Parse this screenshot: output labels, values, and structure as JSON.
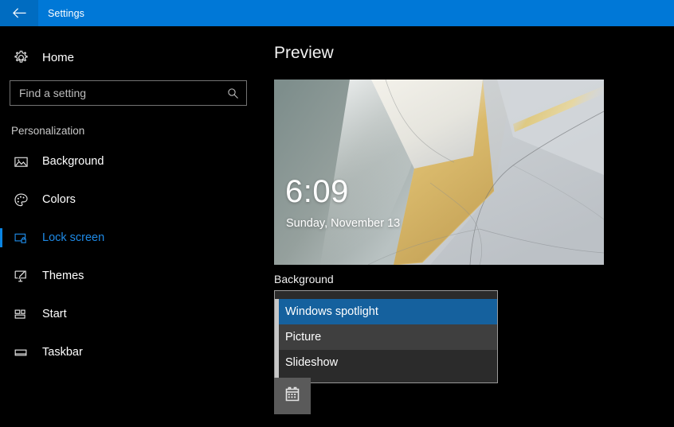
{
  "window": {
    "title": "Settings",
    "back_icon": "back-arrow-icon",
    "accent_color": "#0078d7"
  },
  "sidebar": {
    "home": {
      "label": "Home",
      "icon": "gear-icon"
    },
    "search": {
      "placeholder": "Find a setting",
      "value": "",
      "icon": "search-icon"
    },
    "section_header": "Personalization",
    "items": [
      {
        "label": "Background",
        "icon": "image-icon",
        "selected": false
      },
      {
        "label": "Colors",
        "icon": "palette-icon",
        "selected": false
      },
      {
        "label": "Lock screen",
        "icon": "lock-screen-icon",
        "selected": true
      },
      {
        "label": "Themes",
        "icon": "brush-icon",
        "selected": false
      },
      {
        "label": "Start",
        "icon": "tiles-icon",
        "selected": false
      },
      {
        "label": "Taskbar",
        "icon": "taskbar-icon",
        "selected": false
      }
    ],
    "selected_color": "#1e8ae6",
    "accent_bar_color": "#0a84e2"
  },
  "main": {
    "page_title": "Preview",
    "lock_preview": {
      "clock": "6:09",
      "date": "Sunday, November 13"
    },
    "background_field": {
      "label": "Background",
      "selected_value": "Windows spotlight",
      "options": [
        {
          "label": "Windows spotlight",
          "state": "selected"
        },
        {
          "label": "Picture",
          "state": "hover"
        },
        {
          "label": "Slideshow",
          "state": "normal"
        }
      ],
      "selected_bg_color": "#15619e",
      "hover_bg_color": "#3f3f3f"
    },
    "calendar_tile": {
      "icon": "calendar-icon"
    }
  }
}
